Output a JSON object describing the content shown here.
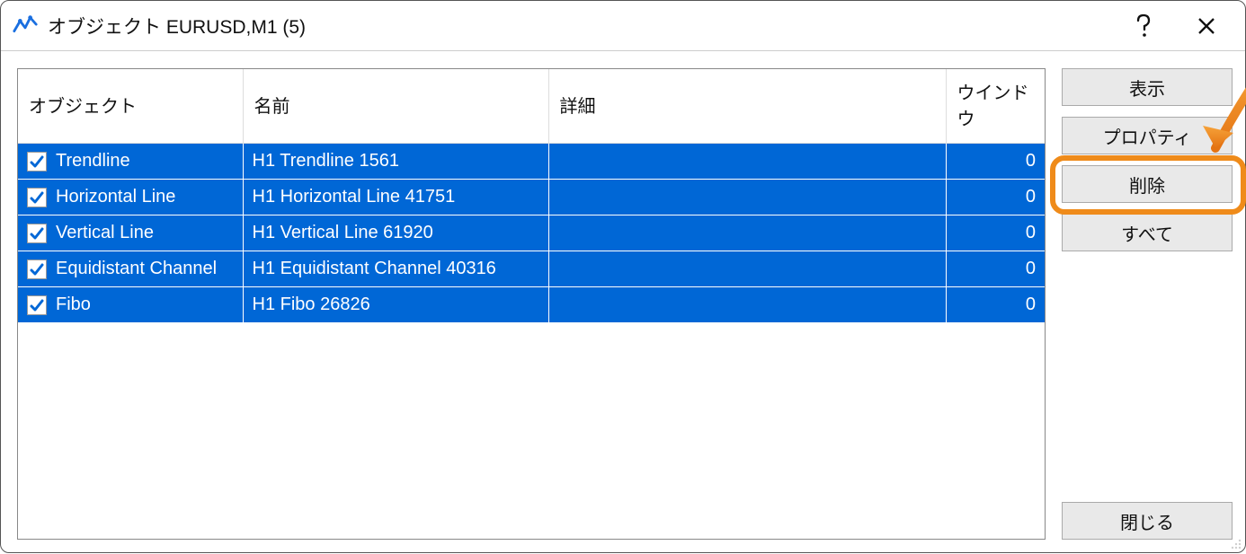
{
  "window": {
    "title": "オブジェクト EURUSD,M1 (5)"
  },
  "columns": {
    "object": "オブジェクト",
    "name": "名前",
    "detail": "詳細",
    "window": "ウインドウ"
  },
  "rows": [
    {
      "checked": true,
      "object": "Trendline",
      "name": "H1 Trendline 1561",
      "detail": "",
      "window": "0"
    },
    {
      "checked": true,
      "object": "Horizontal Line",
      "name": "H1 Horizontal Line 41751",
      "detail": "",
      "window": "0"
    },
    {
      "checked": true,
      "object": "Vertical Line",
      "name": "H1 Vertical Line 61920",
      "detail": "",
      "window": "0"
    },
    {
      "checked": true,
      "object": "Equidistant Channel",
      "name": "H1 Equidistant Channel 40316",
      "detail": "",
      "window": "0"
    },
    {
      "checked": true,
      "object": "Fibo",
      "name": "H1 Fibo 26826",
      "detail": "",
      "window": "0"
    }
  ],
  "buttons": {
    "show": "表示",
    "properties": "プロパティ",
    "delete": "削除",
    "all": "すべて",
    "close": "閉じる"
  }
}
